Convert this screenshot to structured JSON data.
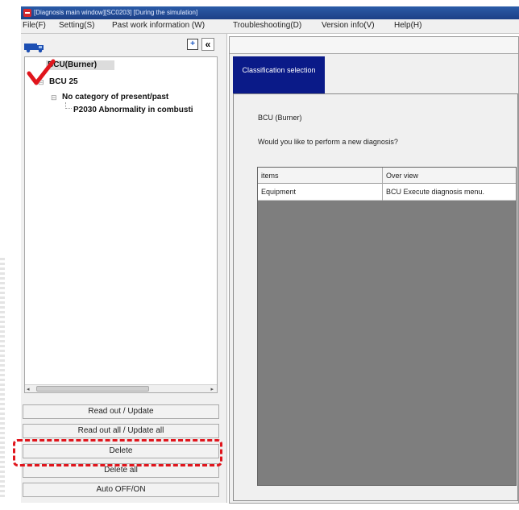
{
  "window": {
    "title": "[Diagnosis main window][SC0203] [During the simulation]"
  },
  "menu": [
    "File(F)",
    "Setting(S)",
    "Past work information (W)",
    "Troubleshooting(D)",
    "Version info(V)",
    "Help(H)"
  ],
  "toolbar": {
    "expand_glyph": "+",
    "collapse_glyph": "«"
  },
  "tree": {
    "root": "BCU(Burner)",
    "child": "BCU 25",
    "grandchild": "No category of present/past",
    "leaf": "P2030 Abnormality in combusti"
  },
  "buttons": {
    "read_out": "Read out / Update",
    "read_out_all": "Read out all / Update all",
    "delete": "Delete",
    "delete_all": "Delete all",
    "auto": "Auto OFF/ON"
  },
  "tab": {
    "label": "Classification selection"
  },
  "content": {
    "unit": "BCU (Burner)",
    "question": "Would you like to perform a new diagnosis?"
  },
  "table": {
    "headers": [
      "items",
      "Over view"
    ],
    "rows": [
      [
        "Equipment",
        "BCU Execute diagnosis menu."
      ]
    ]
  },
  "colors": {
    "highlight": "#e0151c",
    "tab_bg": "#0a1a88",
    "checkmark": "#e0151c"
  }
}
